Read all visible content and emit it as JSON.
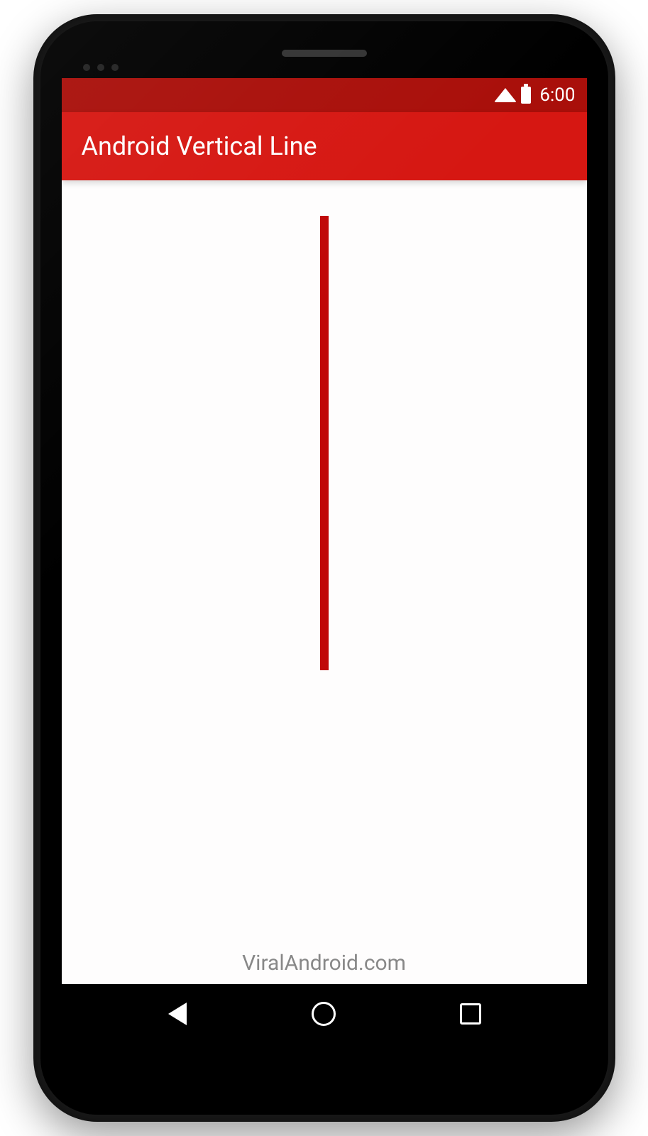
{
  "status_bar": {
    "time": "6:00"
  },
  "app_bar": {
    "title": "Android Vertical Line"
  },
  "content": {
    "line_color": "#c00808",
    "watermark": "ViralAndroid.com"
  },
  "nav": {
    "back": "back",
    "home": "home",
    "recent": "recent"
  }
}
